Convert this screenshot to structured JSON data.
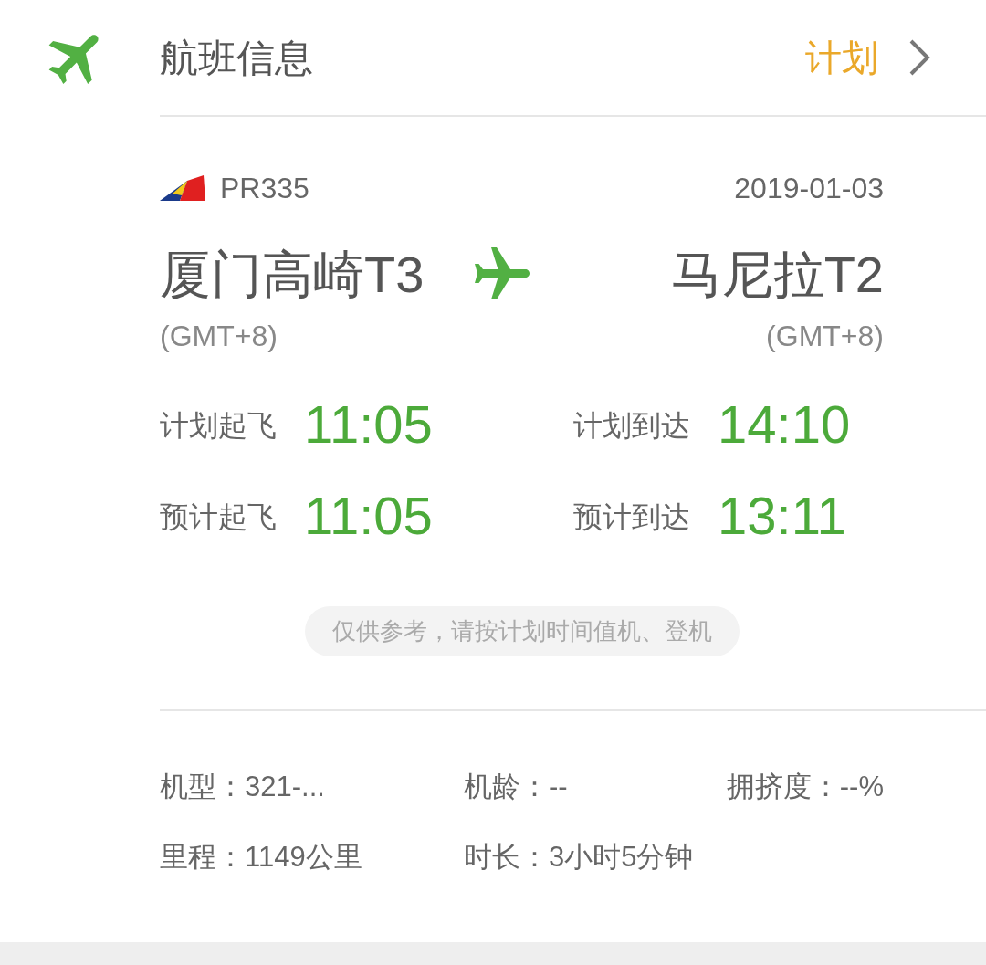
{
  "header": {
    "title": "航班信息",
    "status": "计划"
  },
  "flight": {
    "number": "PR335",
    "date": "2019-01-03"
  },
  "departure": {
    "city": "厦门高崎T3",
    "timezone": "(GMT+8)"
  },
  "arrival": {
    "city": "马尼拉T2",
    "timezone": "(GMT+8)"
  },
  "times": [
    {
      "label": "计划起飞",
      "time": "11:05"
    },
    {
      "label": "计划到达",
      "time": "14:10"
    },
    {
      "label": "预计起飞",
      "time": "11:05"
    },
    {
      "label": "预计到达",
      "time": "13:11"
    }
  ],
  "notice": "仅供参考，请按计划时间值机、登机",
  "details": [
    [
      "机型：321-...",
      "机龄：--",
      "拥挤度：--%"
    ],
    [
      "里程：1149公里",
      "时长：3小时5分钟"
    ]
  ]
}
